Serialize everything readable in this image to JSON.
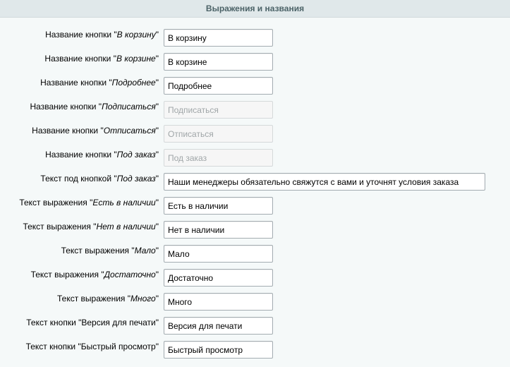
{
  "section": {
    "title": "Выражения и названия"
  },
  "rows": [
    {
      "prefix": "Название кнопки \"",
      "emphasis": "В корзину",
      "suffix": "\"",
      "value": "В корзину",
      "placeholder": "",
      "disabled": false
    },
    {
      "prefix": "Название кнопки \"",
      "emphasis": "В корзине",
      "suffix": "\"",
      "value": "В корзине",
      "placeholder": "",
      "disabled": false
    },
    {
      "prefix": "Название кнопки \"",
      "emphasis": "Подробнее",
      "suffix": "\"",
      "value": "Подробнее",
      "placeholder": "",
      "disabled": false
    },
    {
      "prefix": "Название кнопки \"",
      "emphasis": "Подписаться",
      "suffix": "\"",
      "value": "",
      "placeholder": "Подписаться",
      "disabled": true
    },
    {
      "prefix": "Название кнопки \"",
      "emphasis": "Отписаться",
      "suffix": "\"",
      "value": "",
      "placeholder": "Отписаться",
      "disabled": true
    },
    {
      "prefix": "Название кнопки \"",
      "emphasis": "Под заказ",
      "suffix": "\"",
      "value": "",
      "placeholder": "Под заказ",
      "disabled": true
    },
    {
      "prefix": "Текст под кнопкой \"",
      "emphasis": "Под заказ",
      "suffix": "\"",
      "value": "Наши менеджеры обязательно свяжутся с вами и уточнят условия заказа",
      "placeholder": "",
      "disabled": false
    },
    {
      "prefix": "Текст выражения \"",
      "emphasis": "Есть в наличии",
      "suffix": "\"",
      "value": "Есть в наличии",
      "placeholder": "",
      "disabled": false
    },
    {
      "prefix": "Текст выражения \"",
      "emphasis": "Нет в наличии",
      "suffix": "\"",
      "value": "Нет в наличии",
      "placeholder": "",
      "disabled": false
    },
    {
      "prefix": "Текст выражения \"",
      "emphasis": "Мало",
      "suffix": "\"",
      "value": "Мало",
      "placeholder": "",
      "disabled": false
    },
    {
      "prefix": "Текст выражения \"",
      "emphasis": "Достаточно",
      "suffix": "\"",
      "value": "Достаточно",
      "placeholder": "",
      "disabled": false
    },
    {
      "prefix": "Текст выражения \"",
      "emphasis": "Много",
      "suffix": "\"",
      "value": "Много",
      "placeholder": "",
      "disabled": false
    },
    {
      "prefix": "Текст кнопки \"Версия для печати\"",
      "emphasis": "",
      "suffix": "",
      "value": "Версия для печати",
      "placeholder": "",
      "disabled": false
    },
    {
      "prefix": "Текст кнопки \"Быстрый просмотр\"",
      "emphasis": "",
      "suffix": "",
      "value": "Быстрый просмотр",
      "placeholder": "",
      "disabled": false
    }
  ]
}
